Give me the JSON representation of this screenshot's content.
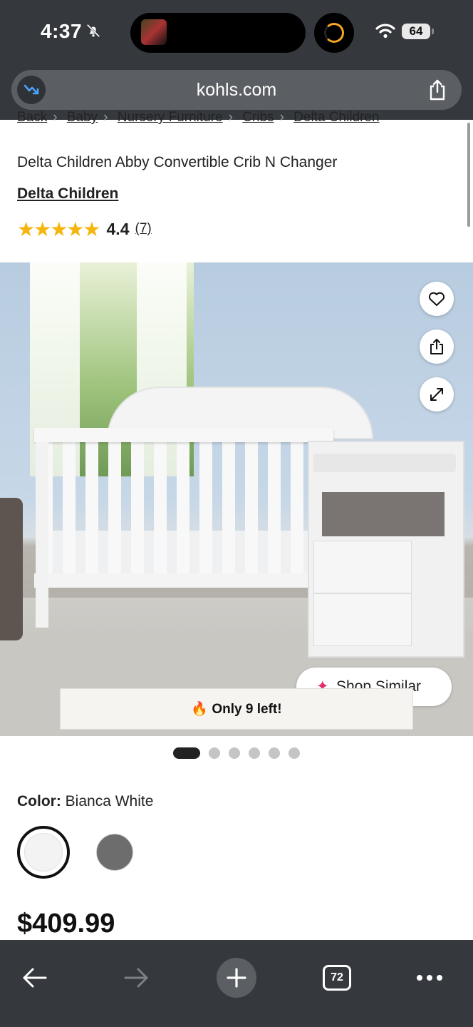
{
  "status_bar": {
    "time": "4:37",
    "battery": "64"
  },
  "browser": {
    "url": "kohls.com",
    "tab_count": "72"
  },
  "breadcrumb": [
    "Back",
    "Baby",
    "Nursery Furniture",
    "Cribs",
    "Delta Children"
  ],
  "product": {
    "title": "Delta Children Abby Convertible Crib N Changer",
    "brand": "Delta Children",
    "rating": 4.4,
    "rating_text": "4.4",
    "review_count": "(7)",
    "shop_similar_label": "Shop Similar",
    "stock_message": "Only 9 left!",
    "image_count": 6,
    "active_image_index": 0,
    "color_label": "Color:",
    "color_value": "Bianca White",
    "swatches": [
      {
        "name": "Bianca White",
        "color": "#f3f3f3",
        "selected": true
      },
      {
        "name": "Gray",
        "color": "#6d6d6d",
        "selected": false
      }
    ],
    "price": "$409.99"
  },
  "colors": {
    "chrome": "#35393d",
    "star": "#f6b50c",
    "text": "#222222"
  },
  "icons": [
    "bell-slash-icon",
    "wifi-icon",
    "trend-icon",
    "share-icon",
    "heart-icon",
    "expand-icon",
    "sparkle-icon",
    "fire-icon",
    "back-arrow-icon",
    "forward-arrow-icon",
    "plus-icon",
    "tabs-icon",
    "more-icon"
  ]
}
